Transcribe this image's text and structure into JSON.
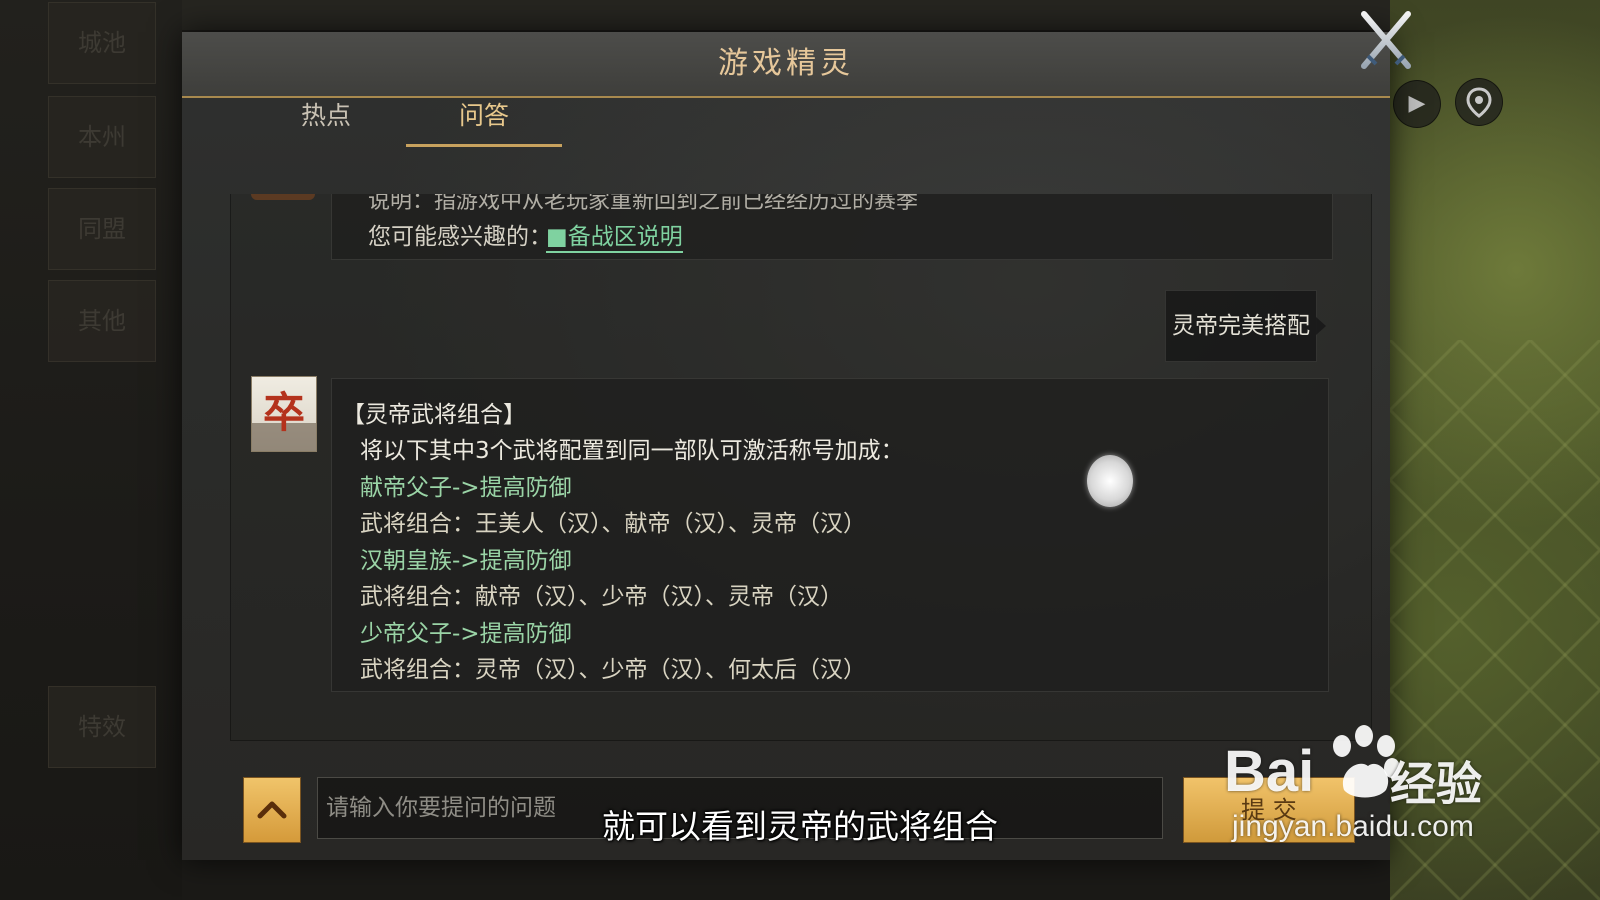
{
  "dialog": {
    "title": "游戏精灵",
    "tabs": [
      {
        "label": "热点",
        "active": false
      },
      {
        "label": "问答",
        "active": true
      }
    ]
  },
  "chat": {
    "prev_message": {
      "cut_text": "说明：指游戏中从老玩家重新回到之前已经经历过的赛季",
      "interest_label": "您可能感兴趣的：",
      "interest_link": "■备战区说明"
    },
    "user_message": "灵帝完美搭配",
    "bot_avatar_char": "卒",
    "bot_lines": [
      "【灵帝武将组合】",
      "将以下其中3个武将配置到同一部队可激活称号加成：",
      "献帝父子->提高防御",
      "武将组合：王美人（汉）、献帝（汉）、灵帝（汉）",
      "汉朝皇族->提高防御",
      "武将组合：献帝（汉）、少帝（汉）、灵帝（汉）",
      "少帝父子->提高防御",
      "武将组合：灵帝（汉）、少帝（汉）、何太后（汉）"
    ]
  },
  "input": {
    "placeholder": "请输入你要提问的问题",
    "send_label": "提 交"
  },
  "background": {
    "left_menu": [
      "城池",
      "本州",
      "同盟",
      "其他",
      "特效"
    ]
  },
  "subtitle": "就可以看到灵帝的武将组合",
  "watermark": {
    "brand_left": "Bai",
    "brand_right": "经验",
    "url": "jingyan.baidu.com"
  },
  "colors": {
    "accent_gold": "#e6c79a",
    "link_green": "#7fd2a0",
    "line_green": "#9ad4a6",
    "button_gold": "#d59a3a"
  }
}
